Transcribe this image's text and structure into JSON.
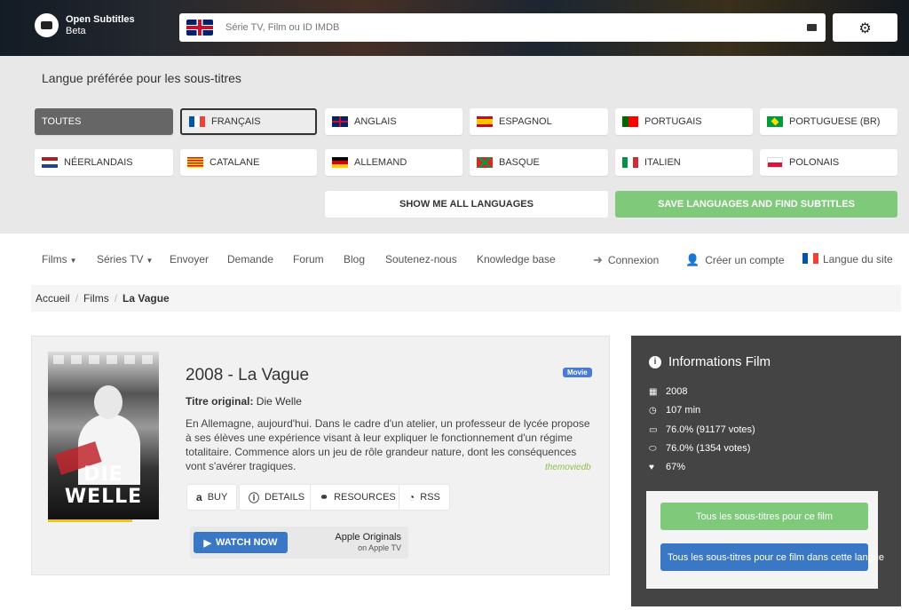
{
  "header": {
    "logo_name": "Open Subtitles",
    "logo_sub": "Beta",
    "search_placeholder": "Série TV, Film ou ID IMDB",
    "settings_icon": "gear-icon"
  },
  "languages": {
    "title": "Langue préférée pour les sous-titres",
    "items": [
      {
        "label": "TOUTES",
        "flag": "",
        "state": "active"
      },
      {
        "label": "FRANÇAIS",
        "flag": "fr",
        "state": "selected"
      },
      {
        "label": "ANGLAIS",
        "flag": "uk",
        "state": ""
      },
      {
        "label": "ESPAGNOL",
        "flag": "es",
        "state": ""
      },
      {
        "label": "PORTUGAIS",
        "flag": "pt",
        "state": ""
      },
      {
        "label": "PORTUGUESE (BR)",
        "flag": "br",
        "state": ""
      },
      {
        "label": "NÉERLANDAIS",
        "flag": "nl",
        "state": ""
      },
      {
        "label": "CATALANE",
        "flag": "ca",
        "state": ""
      },
      {
        "label": "ALLEMAND",
        "flag": "de",
        "state": ""
      },
      {
        "label": "BASQUE",
        "flag": "eu",
        "state": ""
      },
      {
        "label": "ITALIEN",
        "flag": "it",
        "state": ""
      },
      {
        "label": "POLONAIS",
        "flag": "pl",
        "state": ""
      }
    ],
    "show_all": "SHOW ME ALL LANGUAGES",
    "save": "SAVE LANGUAGES AND FIND SUBTITLES"
  },
  "nav": {
    "films": "Films",
    "series": "Séries TV",
    "send": "Envoyer",
    "request": "Demande",
    "forum": "Forum",
    "blog": "Blog",
    "support": "Soutenez-nous",
    "kb": "Knowledge base",
    "login": "Connexion",
    "signup": "Créer un compte",
    "site_lang": "Langue du site"
  },
  "breadcrumb": {
    "home": "Accueil",
    "films": "Films",
    "current": "La Vague"
  },
  "movie": {
    "title": "2008 - La Vague",
    "badge": "Movie",
    "orig_label": "Titre original:",
    "orig_value": "Die Welle",
    "synopsis": "En Allemagne, aujourd'hui. Dans le cadre d'un atelier, un professeur de lycée propose à ses élèves une expérience visant à leur expliquer le fonctionnement d'un régime totalitaire. Commence alors un jeu de rôle grandeur nature, dont les conséquences vont s'avérer tragiques.",
    "source": "themoviedb",
    "poster_title": "DIE WELLE",
    "actions": {
      "buy": "BUY",
      "details": "DETAILS",
      "resources": "RESOURCES",
      "rss": "RSS"
    },
    "watch_now": "WATCH NOW",
    "apple_line1": "Apple Originals",
    "apple_line2": "on Apple TV"
  },
  "info": {
    "title": "Informations Film",
    "year": "2008",
    "duration": "107 min",
    "imdb_rating": "76.0% (91177 votes)",
    "tmdb_rating": "76.0% (1354 votes)",
    "likes": "67%",
    "btn_all": "Tous les sous-titres pour ce film",
    "btn_lang": "Tous les sous-titres pour ce film dans cette langue"
  },
  "colors": {
    "accent_green": "#7fc97a",
    "accent_blue": "#3a78c6",
    "sidebar_dark": "#444444"
  }
}
